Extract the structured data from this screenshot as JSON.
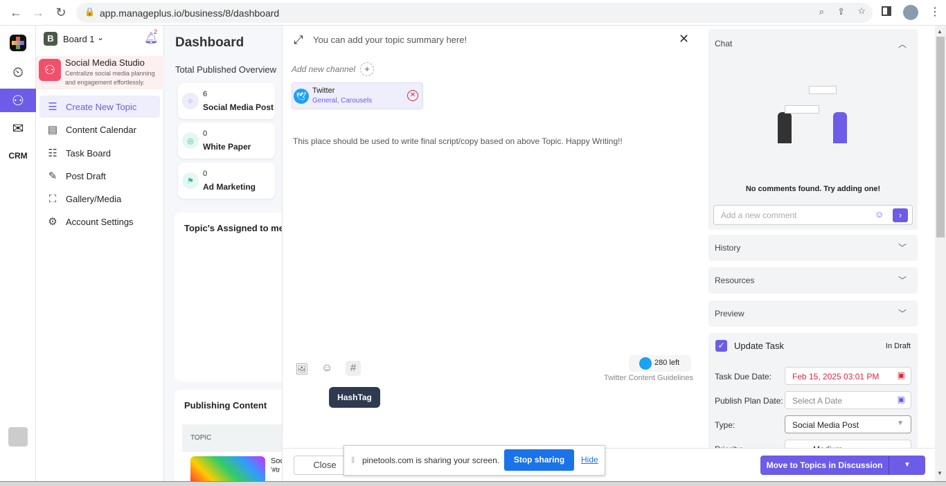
{
  "browser": {
    "url": "app.manageplus.io/business/8/dashboard"
  },
  "colors": {
    "accent": "#6c5ce7",
    "danger": "#e0263f",
    "twitter": "#1da1f2",
    "tooltip": "#2d3a50",
    "share_blue": "#1a73e8"
  },
  "header": {
    "board": "Board 1",
    "board_initial": "B",
    "notification_count": "2"
  },
  "rail": {
    "crm_label": "CRM"
  },
  "studio": {
    "title": "Social Media Studio",
    "subtitle": "Centralize social media planning and engagement effortlessly."
  },
  "sidebar": {
    "items": [
      {
        "label": "Create New Topic",
        "icon": "create-list-icon"
      },
      {
        "label": "Content Calendar",
        "icon": "calendar-icon"
      },
      {
        "label": "Task Board",
        "icon": "checklist-icon"
      },
      {
        "label": "Post Draft",
        "icon": "edit-note-icon"
      },
      {
        "label": "Gallery/Media",
        "icon": "gallery-add-icon"
      },
      {
        "label": "Account Settings",
        "icon": "users-gear-icon"
      }
    ]
  },
  "dashboard": {
    "title": "Dashboard",
    "overview_title": "Total Published Overview",
    "stats": [
      {
        "count": "6",
        "label": "Social Media Post"
      },
      {
        "count": "0",
        "label": "White Paper"
      },
      {
        "count": "0",
        "label": "Ad Marketing"
      }
    ],
    "assigned_title": "Topic's Assigned to me",
    "publishing_title": "Publishing Content",
    "table_header": "TOPIC",
    "row_text1": "Soc",
    "row_text2": "'#tr"
  },
  "editor": {
    "summary_placeholder": "You can add your topic summary here!",
    "add_channel": "Add new channel",
    "channel": {
      "name": "Twitter",
      "sub": "General, Carousels"
    },
    "body_placeholder": "This place should be used to write final script/copy based on above Topic. Happy Writing!!",
    "chars_left": "280 left",
    "guidelines": "Twitter Content Guidelines",
    "tooltip": "HashTag",
    "close": "Close",
    "move": "Move to Topics in Discussion"
  },
  "share_bar": {
    "text": "pinetools.com is sharing your screen.",
    "stop": "Stop sharing",
    "hide": "Hide"
  },
  "right": {
    "chat": "Chat",
    "no_comments": "No comments found. Try adding one!",
    "comment_placeholder": "Add a new comment",
    "history": "History",
    "resources": "Resources",
    "preview": "Preview",
    "update_task": "Update Task",
    "update_checked": true,
    "status": "In Draft",
    "due_label": "Task Due Date:",
    "due_value": "Feb 15, 2025 03:01 PM",
    "publish_label": "Publish Plan Date:",
    "publish_placeholder": "Select A Date",
    "type_label": "Type:",
    "type_value": "Social Media Post",
    "priority_label": "Priority:",
    "priority_value": "Medium"
  }
}
